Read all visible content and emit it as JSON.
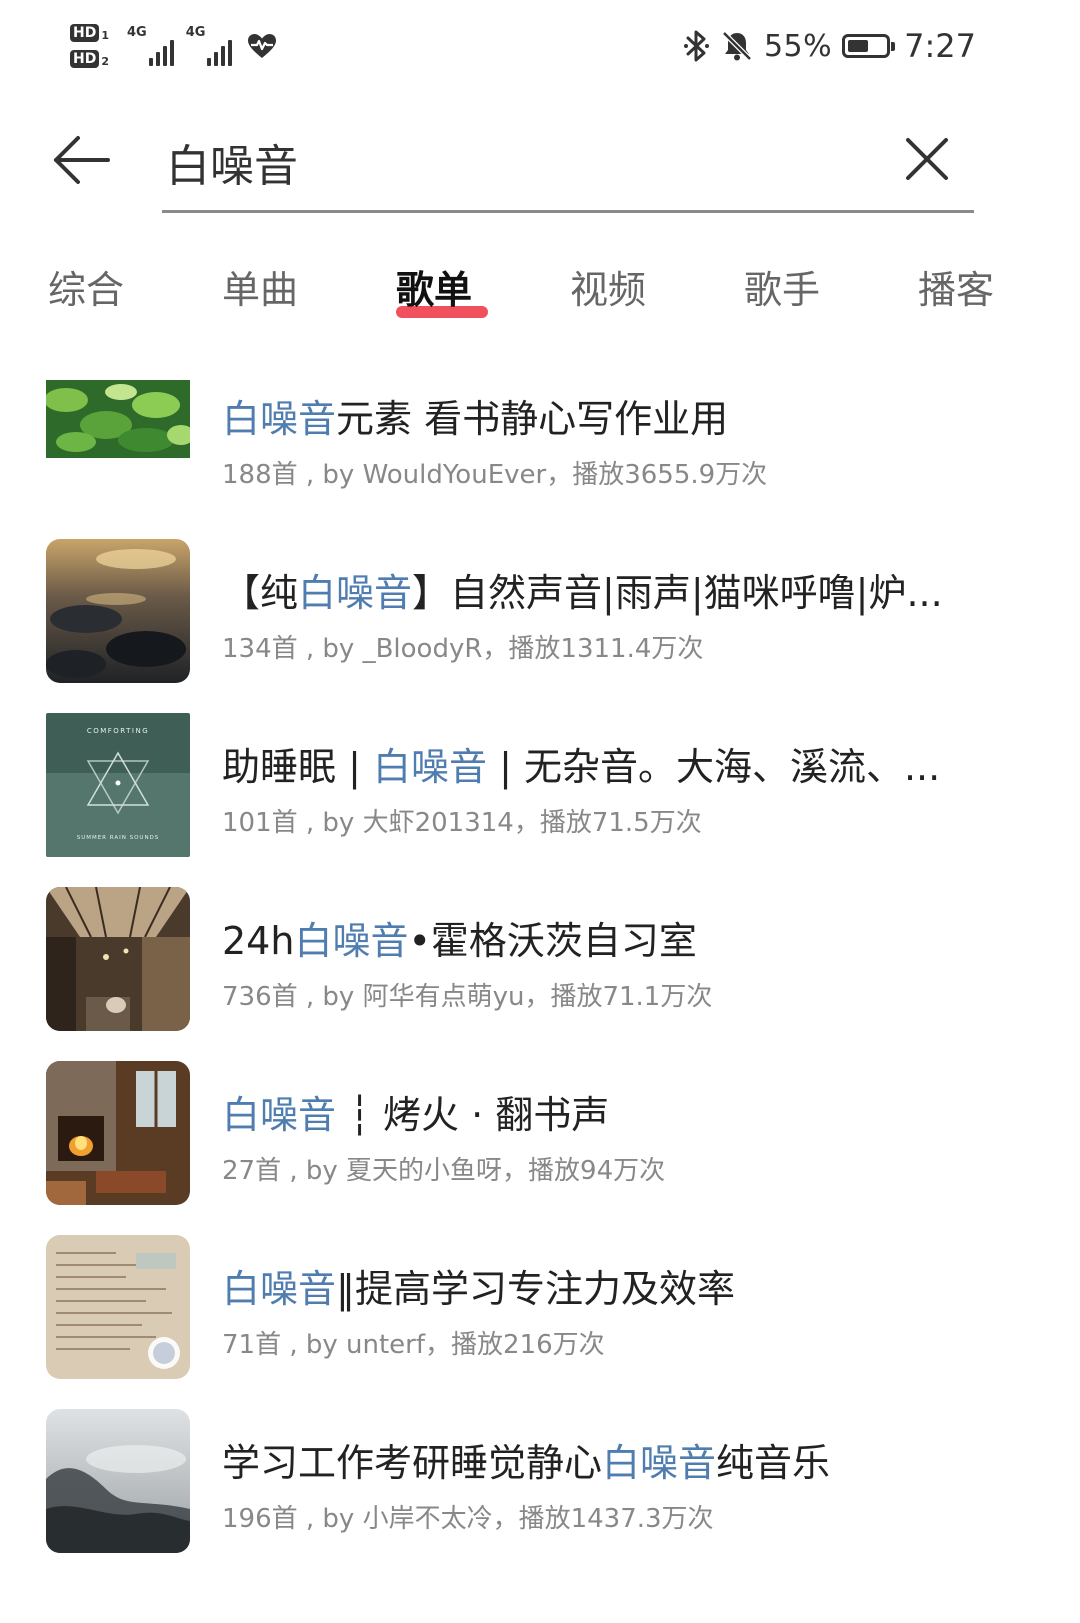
{
  "status_bar": {
    "hd1": "HD",
    "hd1_num": "1",
    "hd2": "HD",
    "hd2_num": "2",
    "net1": "4G",
    "net2": "4G",
    "battery_pct": "55%",
    "battery_level": 0.55,
    "time": "7:27",
    "icons": [
      "hd-icon",
      "signal-icon",
      "heart-health-icon",
      "bluetooth-icon",
      "bell-muted-icon",
      "battery-icon"
    ]
  },
  "search": {
    "query": "白噪音",
    "back_icon": "arrow-left-icon",
    "clear_icon": "close-icon"
  },
  "tabs": [
    {
      "label": "综合",
      "active": false
    },
    {
      "label": "单曲",
      "active": false
    },
    {
      "label": "歌单",
      "active": true
    },
    {
      "label": "视频",
      "active": false
    },
    {
      "label": "歌手",
      "active": false
    },
    {
      "label": "播客",
      "active": false
    }
  ],
  "accent_color": "#ee3340",
  "highlight_color": "#507daf",
  "playlists": [
    {
      "title_parts": [
        {
          "text": "白噪音",
          "hl": true
        },
        {
          "text": "元素 看书静心写作业用",
          "hl": false
        }
      ],
      "meta": "188首 , by WouldYouEver，播放3655.9万次",
      "cover": "green-leaves-cover"
    },
    {
      "title_parts": [
        {
          "text": "【纯",
          "hl": false
        },
        {
          "text": "白噪音",
          "hl": true
        },
        {
          "text": "】自然声音|雨声|猫咪呼噜|炉...",
          "hl": false
        }
      ],
      "meta": "134首 , by _BloodyR，播放1311.4万次",
      "cover": "sunset-water-cover"
    },
    {
      "title_parts": [
        {
          "text": "助睡眠 | ",
          "hl": false
        },
        {
          "text": "白噪音",
          "hl": true
        },
        {
          "text": " | 无杂音。大海、溪流、...",
          "hl": false
        }
      ],
      "meta": "101首 , by 大虾201314，播放71.5万次",
      "cover": "comforting-album-cover",
      "cover_text_top": "COMFORTING",
      "cover_text_bottom": "SUMMER RAIN SOUNDS"
    },
    {
      "title_parts": [
        {
          "text": "24h",
          "hl": false
        },
        {
          "text": "白噪音",
          "hl": true
        },
        {
          "text": "•霍格沃茨自习室",
          "hl": false
        }
      ],
      "meta": "736首 , by 阿华有点萌yu，播放71.1万次",
      "cover": "station-hall-cover"
    },
    {
      "title_parts": [
        {
          "text": "白噪音",
          "hl": true
        },
        {
          "text": " ┆ 烤火 · 翻书声",
          "hl": false
        }
      ],
      "meta": "27首 , by 夏天的小鱼呀，播放94万次",
      "cover": "fireplace-room-cover"
    },
    {
      "title_parts": [
        {
          "text": "白噪音",
          "hl": true
        },
        {
          "text": "‖提高学习专注力及效率",
          "hl": false
        }
      ],
      "meta": "71首 , by unterf，播放216万次",
      "cover": "study-notes-cover"
    },
    {
      "title_parts": [
        {
          "text": "学习工作考研睡觉静心",
          "hl": false
        },
        {
          "text": "白噪音",
          "hl": true
        },
        {
          "text": "纯音乐",
          "hl": false
        }
      ],
      "meta": "196首 , by 小岸不太冷，播放1437.3万次",
      "cover": "misty-mountain-cover"
    }
  ]
}
